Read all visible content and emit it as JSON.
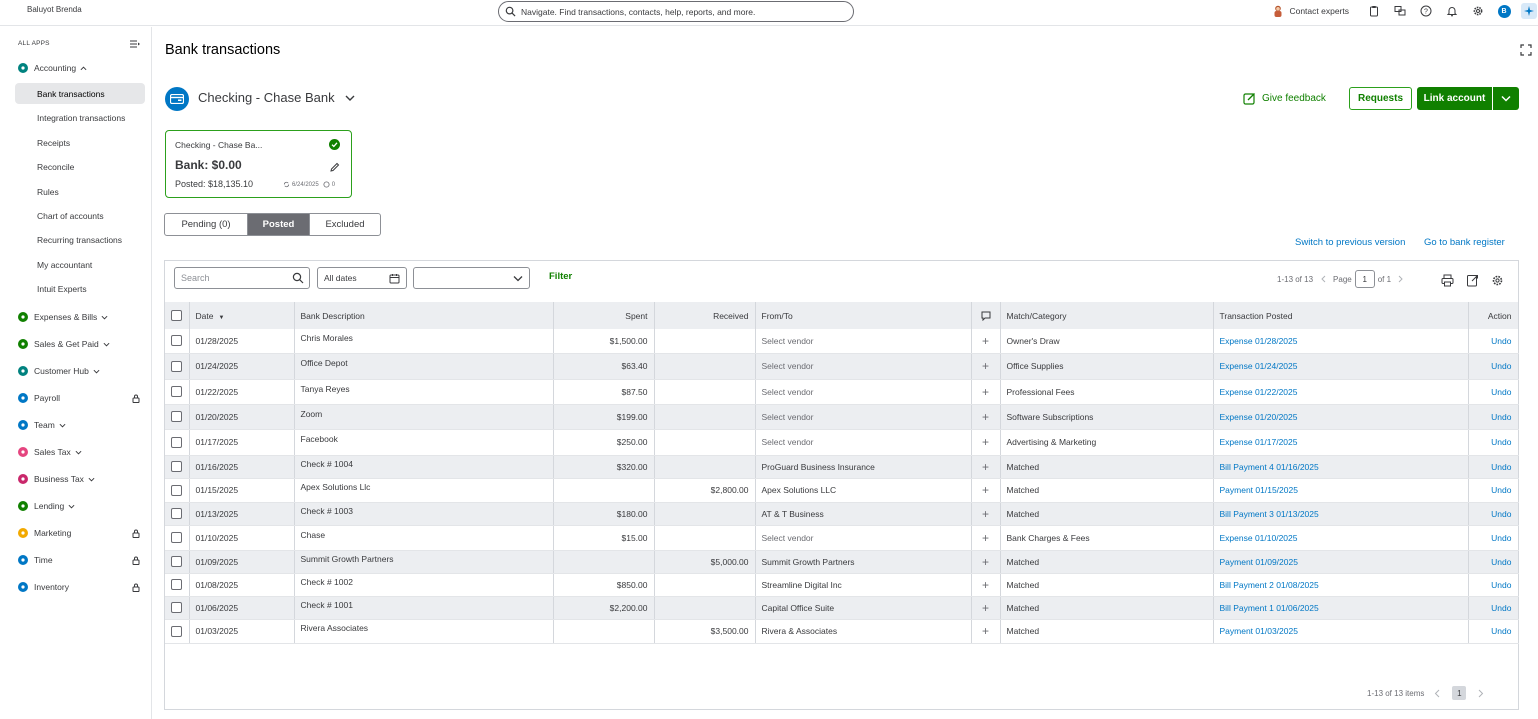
{
  "topbar": {
    "company": "Baluyot Brenda",
    "search_placeholder": "Navigate. Find transactions, contacts, help, reports, and more.",
    "contact_experts": "Contact experts",
    "avatar_initial": "B"
  },
  "sidebar": {
    "all_apps": "ALL APPS",
    "accounting": "Accounting",
    "sub_items": [
      "Bank transactions",
      "Integration transactions",
      "Receipts",
      "Reconcile",
      "Rules",
      "Chart of accounts",
      "Recurring transactions",
      "My accountant",
      "Intuit Experts"
    ],
    "apps": [
      {
        "label": "Expenses & Bills",
        "color": "#108000",
        "locked": false,
        "chevron": true
      },
      {
        "label": "Sales & Get Paid",
        "color": "#108000",
        "locked": false,
        "chevron": true
      },
      {
        "label": "Customer Hub",
        "color": "#00827f",
        "locked": false,
        "chevron": true
      },
      {
        "label": "Payroll",
        "color": "#0077c5",
        "locked": true,
        "chevron": false
      },
      {
        "label": "Team",
        "color": "#0077c5",
        "locked": false,
        "chevron": true
      },
      {
        "label": "Sales Tax",
        "color": "#e5457f",
        "locked": false,
        "chevron": true
      },
      {
        "label": "Business Tax",
        "color": "#c9276b",
        "locked": false,
        "chevron": true
      },
      {
        "label": "Lending",
        "color": "#108000",
        "locked": false,
        "chevron": true
      },
      {
        "label": "Marketing",
        "color": "#f2a900",
        "locked": true,
        "chevron": false
      },
      {
        "label": "Time",
        "color": "#0077c5",
        "locked": true,
        "chevron": false
      },
      {
        "label": "Inventory",
        "color": "#0077c5",
        "locked": true,
        "chevron": false
      }
    ]
  },
  "main": {
    "title": "Bank transactions",
    "account_name": "Checking - Chase Bank",
    "give_feedback": "Give feedback",
    "requests": "Requests",
    "link_account": "Link account",
    "card": {
      "name": "Checking - Chase Ba...",
      "bank": "Bank: $0.00",
      "posted": "Posted: $18,135.10",
      "date": "6/24/2025",
      "comments": "0"
    },
    "tabs": [
      "Pending (0)",
      "Posted",
      "Excluded"
    ],
    "active_tab": "Posted",
    "switch_prev": "Switch to previous version",
    "go_register": "Go to bank register"
  },
  "toolbar": {
    "search_placeholder": "Search",
    "dates": "All dates",
    "filter": "Filter",
    "range": "1-13 of 13",
    "page_label": "Page",
    "page_value": "1",
    "of_pages": "of 1"
  },
  "table": {
    "headers": [
      "Date",
      "Bank Description",
      "Spent",
      "Received",
      "From/To",
      "Match/Category",
      "Transaction Posted",
      "Action"
    ],
    "rows": [
      {
        "date": "01/28/2025",
        "desc": "Chris Morales",
        "spent": "$1,500.00",
        "received": "",
        "from_to": "Select vendor",
        "placeholder": true,
        "category": "Owner's Draw",
        "posted": "Expense 01/28/2025",
        "action": "Undo"
      },
      {
        "date": "01/24/2025",
        "desc": "Office Depot",
        "spent": "$63.40",
        "received": "",
        "from_to": "Select vendor",
        "placeholder": true,
        "category": "Office Supplies",
        "posted": "Expense 01/24/2025",
        "action": "Undo"
      },
      {
        "date": "01/22/2025",
        "desc": "Tanya Reyes",
        "spent": "$87.50",
        "received": "",
        "from_to": "Select vendor",
        "placeholder": true,
        "category": "Professional Fees",
        "posted": "Expense 01/22/2025",
        "action": "Undo"
      },
      {
        "date": "01/20/2025",
        "desc": "Zoom",
        "spent": "$199.00",
        "received": "",
        "from_to": "Select vendor",
        "placeholder": true,
        "category": "Software Subscriptions",
        "posted": "Expense 01/20/2025",
        "action": "Undo"
      },
      {
        "date": "01/17/2025",
        "desc": "Facebook",
        "spent": "$250.00",
        "received": "",
        "from_to": "Select vendor",
        "placeholder": true,
        "category": "Advertising & Marketing",
        "posted": "Expense 01/17/2025",
        "action": "Undo"
      },
      {
        "date": "01/16/2025",
        "desc": "Check # 1004",
        "spent": "$320.00",
        "received": "",
        "from_to": "ProGuard Business Insurance",
        "placeholder": false,
        "category": "Matched",
        "posted": "Bill Payment 4 01/16/2025",
        "action": "Undo"
      },
      {
        "date": "01/15/2025",
        "desc": "Apex Solutions Llc",
        "spent": "",
        "received": "$2,800.00",
        "from_to": "Apex Solutions LLC",
        "placeholder": false,
        "category": "Matched",
        "posted": "Payment 01/15/2025",
        "action": "Undo"
      },
      {
        "date": "01/13/2025",
        "desc": "Check # 1003",
        "spent": "$180.00",
        "received": "",
        "from_to": "AT & T Business",
        "placeholder": false,
        "category": "Matched",
        "posted": "Bill Payment 3 01/13/2025",
        "action": "Undo"
      },
      {
        "date": "01/10/2025",
        "desc": "Chase",
        "spent": "$15.00",
        "received": "",
        "from_to": "Select vendor",
        "placeholder": true,
        "category": "Bank Charges & Fees",
        "posted": "Expense 01/10/2025",
        "action": "Undo"
      },
      {
        "date": "01/09/2025",
        "desc": "Summit Growth Partners",
        "spent": "",
        "received": "$5,000.00",
        "from_to": "Summit Growth Partners",
        "placeholder": false,
        "category": "Matched",
        "posted": "Payment 01/09/2025",
        "action": "Undo"
      },
      {
        "date": "01/08/2025",
        "desc": "Check # 1002",
        "spent": "$850.00",
        "received": "",
        "from_to": "Streamline Digital Inc",
        "placeholder": false,
        "category": "Matched",
        "posted": "Bill Payment 2 01/08/2025",
        "action": "Undo"
      },
      {
        "date": "01/06/2025",
        "desc": "Check # 1001",
        "spent": "$2,200.00",
        "received": "",
        "from_to": "Capital Office Suite",
        "placeholder": false,
        "category": "Matched",
        "posted": "Bill Payment 1 01/06/2025",
        "action": "Undo"
      },
      {
        "date": "01/03/2025",
        "desc": "Rivera Associates",
        "spent": "",
        "received": "$3,500.00",
        "from_to": "Rivera & Associates",
        "placeholder": false,
        "category": "Matched",
        "posted": "Payment 01/03/2025",
        "action": "Undo"
      }
    ]
  },
  "footer": {
    "range": "1-13 of 13 items",
    "current_page": "1"
  },
  "colors": {
    "brand_green": "#108000",
    "link_blue": "#0077c5"
  }
}
